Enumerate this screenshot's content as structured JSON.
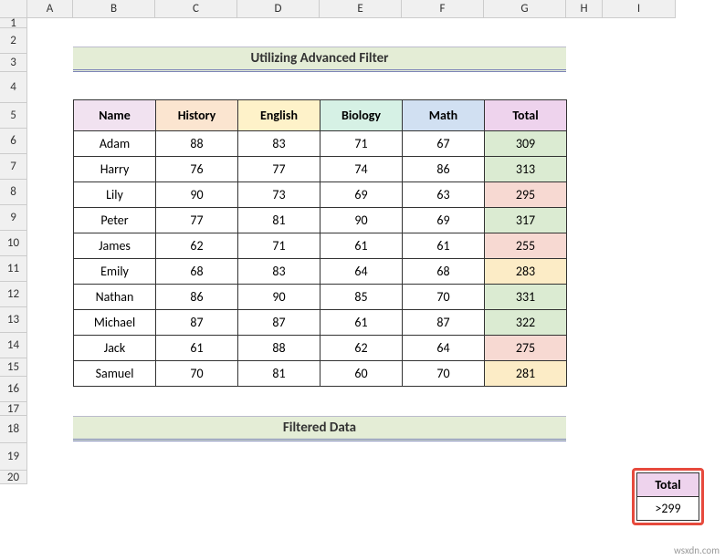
{
  "columns": [
    "A",
    "B",
    "C",
    "D",
    "E",
    "F",
    "G",
    "H",
    "I"
  ],
  "rows": [
    "1",
    "2",
    "3",
    "4",
    "5",
    "6",
    "7",
    "8",
    "9",
    "10",
    "11",
    "12",
    "13",
    "14",
    "15",
    "16",
    "17",
    "18",
    "19",
    "20"
  ],
  "title_main": "Utilizing Advanced Filter",
  "title_filtered": "Filtered Data",
  "headers": {
    "name": "Name",
    "history": "History",
    "english": "English",
    "biology": "Biology",
    "math": "Math",
    "total": "Total"
  },
  "data": [
    {
      "name": "Adam",
      "history": "88",
      "english": "83",
      "biology": "71",
      "math": "67",
      "total": "309",
      "tot_class": "tot-green"
    },
    {
      "name": "Harry",
      "history": "76",
      "english": "77",
      "biology": "74",
      "math": "86",
      "total": "313",
      "tot_class": "tot-green"
    },
    {
      "name": "Lily",
      "history": "90",
      "english": "73",
      "biology": "69",
      "math": "63",
      "total": "295",
      "tot_class": "tot-red"
    },
    {
      "name": "Peter",
      "history": "77",
      "english": "81",
      "biology": "90",
      "math": "69",
      "total": "317",
      "tot_class": "tot-green"
    },
    {
      "name": "James",
      "history": "62",
      "english": "71",
      "biology": "61",
      "math": "61",
      "total": "255",
      "tot_class": "tot-red"
    },
    {
      "name": "Emily",
      "history": "68",
      "english": "83",
      "biology": "64",
      "math": "68",
      "total": "283",
      "tot_class": "tot-yellow"
    },
    {
      "name": "Nathan",
      "history": "86",
      "english": "90",
      "biology": "85",
      "math": "70",
      "total": "331",
      "tot_class": "tot-green"
    },
    {
      "name": "Michael",
      "history": "87",
      "english": "87",
      "biology": "61",
      "math": "87",
      "total": "322",
      "tot_class": "tot-green"
    },
    {
      "name": "Jack",
      "history": "61",
      "english": "88",
      "biology": "62",
      "math": "64",
      "total": "275",
      "tot_class": "tot-red"
    },
    {
      "name": "Samuel",
      "history": "70",
      "english": "81",
      "biology": "60",
      "math": "70",
      "total": "281",
      "tot_class": "tot-yellow"
    }
  ],
  "criteria": {
    "header": "Total",
    "value": ">299"
  },
  "watermark": "wsxdn.com",
  "chart_data": {
    "type": "table",
    "columns": [
      "Name",
      "History",
      "English",
      "Biology",
      "Math",
      "Total"
    ],
    "rows": [
      [
        "Adam",
        88,
        83,
        71,
        67,
        309
      ],
      [
        "Harry",
        76,
        77,
        74,
        86,
        313
      ],
      [
        "Lily",
        90,
        73,
        69,
        63,
        295
      ],
      [
        "Peter",
        77,
        81,
        90,
        69,
        317
      ],
      [
        "James",
        62,
        71,
        61,
        61,
        255
      ],
      [
        "Emily",
        68,
        83,
        64,
        68,
        283
      ],
      [
        "Nathan",
        86,
        90,
        85,
        70,
        331
      ],
      [
        "Michael",
        87,
        87,
        61,
        87,
        322
      ],
      [
        "Jack",
        61,
        88,
        62,
        64,
        275
      ],
      [
        "Samuel",
        70,
        81,
        60,
        70,
        281
      ]
    ],
    "title": "Utilizing Advanced Filter"
  }
}
